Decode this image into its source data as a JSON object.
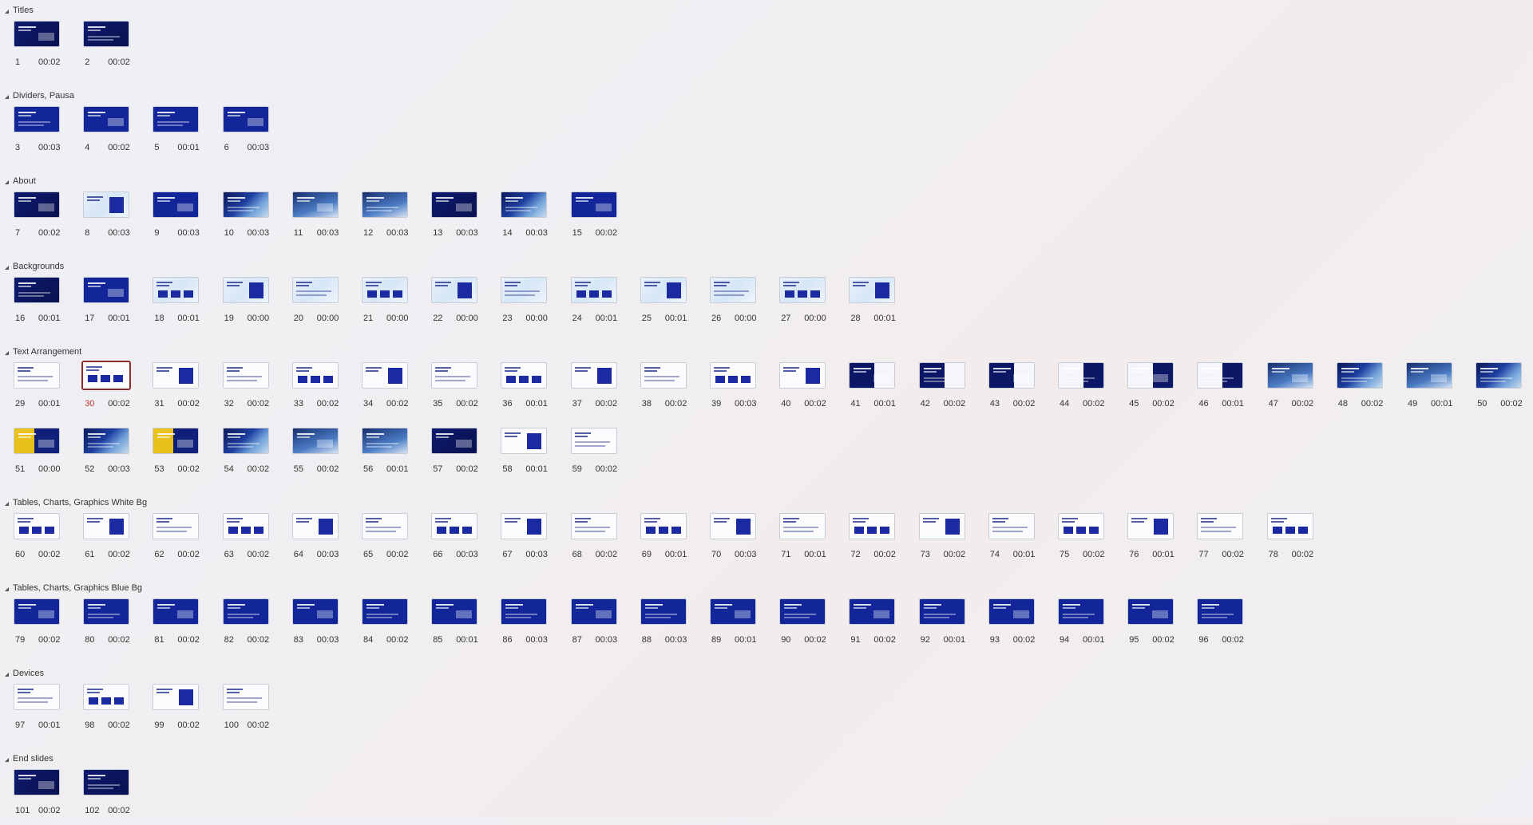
{
  "sections": [
    {
      "title": "Titles",
      "slides": [
        {
          "n": "1",
          "t": "00:02",
          "style": "dark"
        },
        {
          "n": "2",
          "t": "00:02",
          "style": "dark"
        }
      ]
    },
    {
      "title": "Dividers, Pausa",
      "slides": [
        {
          "n": "3",
          "t": "00:03",
          "style": "blue"
        },
        {
          "n": "4",
          "t": "00:02",
          "style": "blue"
        },
        {
          "n": "5",
          "t": "00:01",
          "style": "blue"
        },
        {
          "n": "6",
          "t": "00:03",
          "style": "blue"
        }
      ]
    },
    {
      "title": "About",
      "slides": [
        {
          "n": "7",
          "t": "00:02",
          "style": "dark"
        },
        {
          "n": "8",
          "t": "00:03",
          "style": "light"
        },
        {
          "n": "9",
          "t": "00:03",
          "style": "blue"
        },
        {
          "n": "10",
          "t": "00:03",
          "style": "photo"
        },
        {
          "n": "11",
          "t": "00:03",
          "style": "sky"
        },
        {
          "n": "12",
          "t": "00:03",
          "style": "sky"
        },
        {
          "n": "13",
          "t": "00:03",
          "style": "dark"
        },
        {
          "n": "14",
          "t": "00:03",
          "style": "photo"
        },
        {
          "n": "15",
          "t": "00:02",
          "style": "blue"
        }
      ]
    },
    {
      "title": "Backgrounds",
      "slides": [
        {
          "n": "16",
          "t": "00:01",
          "style": "dark"
        },
        {
          "n": "17",
          "t": "00:01",
          "style": "blue"
        },
        {
          "n": "18",
          "t": "00:01",
          "style": "light"
        },
        {
          "n": "19",
          "t": "00:00",
          "style": "light"
        },
        {
          "n": "20",
          "t": "00:00",
          "style": "light"
        },
        {
          "n": "21",
          "t": "00:00",
          "style": "light"
        },
        {
          "n": "22",
          "t": "00:00",
          "style": "light"
        },
        {
          "n": "23",
          "t": "00:00",
          "style": "light"
        },
        {
          "n": "24",
          "t": "00:01",
          "style": "light"
        },
        {
          "n": "25",
          "t": "00:01",
          "style": "light"
        },
        {
          "n": "26",
          "t": "00:00",
          "style": "light"
        },
        {
          "n": "27",
          "t": "00:00",
          "style": "light"
        },
        {
          "n": "28",
          "t": "00:01",
          "style": "light"
        }
      ]
    },
    {
      "title": "Text Arrangement",
      "slides": [
        {
          "n": "29",
          "t": "00:01",
          "style": "white"
        },
        {
          "n": "30",
          "t": "00:02",
          "style": "white",
          "selected": true
        },
        {
          "n": "31",
          "t": "00:02",
          "style": "white"
        },
        {
          "n": "32",
          "t": "00:02",
          "style": "white"
        },
        {
          "n": "33",
          "t": "00:02",
          "style": "white"
        },
        {
          "n": "34",
          "t": "00:02",
          "style": "white"
        },
        {
          "n": "35",
          "t": "00:02",
          "style": "white"
        },
        {
          "n": "36",
          "t": "00:01",
          "style": "white"
        },
        {
          "n": "37",
          "t": "00:02",
          "style": "white"
        },
        {
          "n": "38",
          "t": "00:02",
          "style": "white"
        },
        {
          "n": "39",
          "t": "00:03",
          "style": "white"
        },
        {
          "n": "40",
          "t": "00:02",
          "style": "white"
        },
        {
          "n": "41",
          "t": "00:01",
          "style": "split"
        },
        {
          "n": "42",
          "t": "00:02",
          "style": "split"
        },
        {
          "n": "43",
          "t": "00:02",
          "style": "split"
        },
        {
          "n": "44",
          "t": "00:02",
          "style": "splitr"
        },
        {
          "n": "45",
          "t": "00:02",
          "style": "splitr"
        },
        {
          "n": "46",
          "t": "00:01",
          "style": "splitr"
        },
        {
          "n": "47",
          "t": "00:02",
          "style": "sky"
        },
        {
          "n": "48",
          "t": "00:02",
          "style": "photo"
        },
        {
          "n": "49",
          "t": "00:01",
          "style": "sky"
        },
        {
          "n": "50",
          "t": "00:02",
          "style": "photo"
        },
        {
          "n": "51",
          "t": "00:00",
          "style": "yellow"
        },
        {
          "n": "52",
          "t": "00:03",
          "style": "photo"
        },
        {
          "n": "53",
          "t": "00:02",
          "style": "yellow"
        },
        {
          "n": "54",
          "t": "00:02",
          "style": "photo"
        },
        {
          "n": "55",
          "t": "00:02",
          "style": "sky"
        },
        {
          "n": "56",
          "t": "00:01",
          "style": "sky"
        },
        {
          "n": "57",
          "t": "00:02",
          "style": "dark"
        },
        {
          "n": "58",
          "t": "00:01",
          "style": "white"
        },
        {
          "n": "59",
          "t": "00:02",
          "style": "white"
        }
      ]
    },
    {
      "title": "Tables, Charts, Graphics White Bg",
      "slides": [
        {
          "n": "60",
          "t": "00:02",
          "style": "white"
        },
        {
          "n": "61",
          "t": "00:02",
          "style": "white"
        },
        {
          "n": "62",
          "t": "00:02",
          "style": "white"
        },
        {
          "n": "63",
          "t": "00:02",
          "style": "white"
        },
        {
          "n": "64",
          "t": "00:03",
          "style": "white"
        },
        {
          "n": "65",
          "t": "00:02",
          "style": "white"
        },
        {
          "n": "66",
          "t": "00:03",
          "style": "white"
        },
        {
          "n": "67",
          "t": "00:03",
          "style": "white"
        },
        {
          "n": "68",
          "t": "00:02",
          "style": "white"
        },
        {
          "n": "69",
          "t": "00:01",
          "style": "white"
        },
        {
          "n": "70",
          "t": "00:03",
          "style": "white"
        },
        {
          "n": "71",
          "t": "00:01",
          "style": "white"
        },
        {
          "n": "72",
          "t": "00:02",
          "style": "white"
        },
        {
          "n": "73",
          "t": "00:02",
          "style": "white"
        },
        {
          "n": "74",
          "t": "00:01",
          "style": "white"
        },
        {
          "n": "75",
          "t": "00:02",
          "style": "white"
        },
        {
          "n": "76",
          "t": "00:01",
          "style": "white"
        },
        {
          "n": "77",
          "t": "00:02",
          "style": "white"
        },
        {
          "n": "78",
          "t": "00:02",
          "style": "white"
        }
      ]
    },
    {
      "title": "Tables, Charts, Graphics Blue Bg",
      "slides": [
        {
          "n": "79",
          "t": "00:02",
          "style": "blue"
        },
        {
          "n": "80",
          "t": "00:02",
          "style": "blue"
        },
        {
          "n": "81",
          "t": "00:02",
          "style": "blue"
        },
        {
          "n": "82",
          "t": "00:02",
          "style": "blue"
        },
        {
          "n": "83",
          "t": "00:03",
          "style": "blue"
        },
        {
          "n": "84",
          "t": "00:02",
          "style": "blue"
        },
        {
          "n": "85",
          "t": "00:01",
          "style": "blue"
        },
        {
          "n": "86",
          "t": "00:03",
          "style": "blue"
        },
        {
          "n": "87",
          "t": "00:03",
          "style": "blue"
        },
        {
          "n": "88",
          "t": "00:03",
          "style": "blue"
        },
        {
          "n": "89",
          "t": "00:01",
          "style": "blue"
        },
        {
          "n": "90",
          "t": "00:02",
          "style": "blue"
        },
        {
          "n": "91",
          "t": "00:02",
          "style": "blue"
        },
        {
          "n": "92",
          "t": "00:01",
          "style": "blue"
        },
        {
          "n": "93",
          "t": "00:02",
          "style": "blue"
        },
        {
          "n": "94",
          "t": "00:01",
          "style": "blue"
        },
        {
          "n": "95",
          "t": "00:02",
          "style": "blue"
        },
        {
          "n": "96",
          "t": "00:02",
          "style": "blue"
        }
      ]
    },
    {
      "title": "Devices",
      "slides": [
        {
          "n": "97",
          "t": "00:01",
          "style": "white"
        },
        {
          "n": "98",
          "t": "00:02",
          "style": "white"
        },
        {
          "n": "99",
          "t": "00:02",
          "style": "white"
        },
        {
          "n": "100",
          "t": "00:02",
          "style": "white"
        }
      ]
    },
    {
      "title": "End slides",
      "slides": [
        {
          "n": "101",
          "t": "00:02",
          "style": "dark"
        },
        {
          "n": "102",
          "t": "00:02",
          "style": "dark"
        }
      ]
    }
  ]
}
